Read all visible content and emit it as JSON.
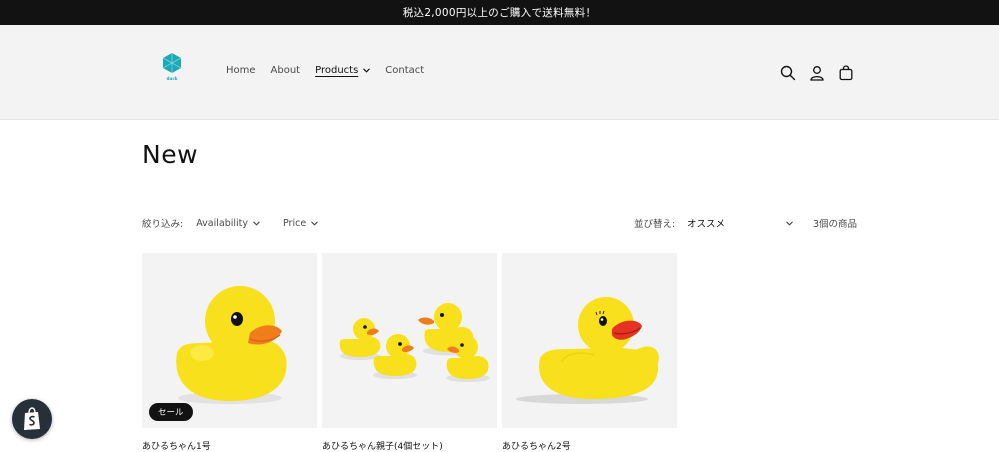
{
  "announcement": {
    "text": "税込2,000円以上のご購入で送料無料！"
  },
  "header": {
    "logo_text": "duck",
    "nav": [
      {
        "label": "Home"
      },
      {
        "label": "About"
      },
      {
        "label": "Products",
        "active": true
      },
      {
        "label": "Contact"
      }
    ],
    "icons": [
      "search-icon",
      "account-icon",
      "cart-icon"
    ]
  },
  "page": {
    "title": "New"
  },
  "filters": {
    "label": "絞り込み:",
    "availability": "Availability",
    "price": "Price",
    "sort_label": "並び替え:",
    "sort_value": "オススメ",
    "count": "3個の商品"
  },
  "products": [
    {
      "title": "あひるちゃん1号",
      "badge": "セール"
    },
    {
      "title": "あひるちゃん親子(4個セット)"
    },
    {
      "title": "あひるちゃん2号"
    }
  ],
  "colors": {
    "accent": "#1aa9b6",
    "announcement_bg": "#121212",
    "header_bg": "#f3f3f3",
    "duck_yellow": "#f8e01c",
    "beak_orange": "#f07d1c"
  }
}
